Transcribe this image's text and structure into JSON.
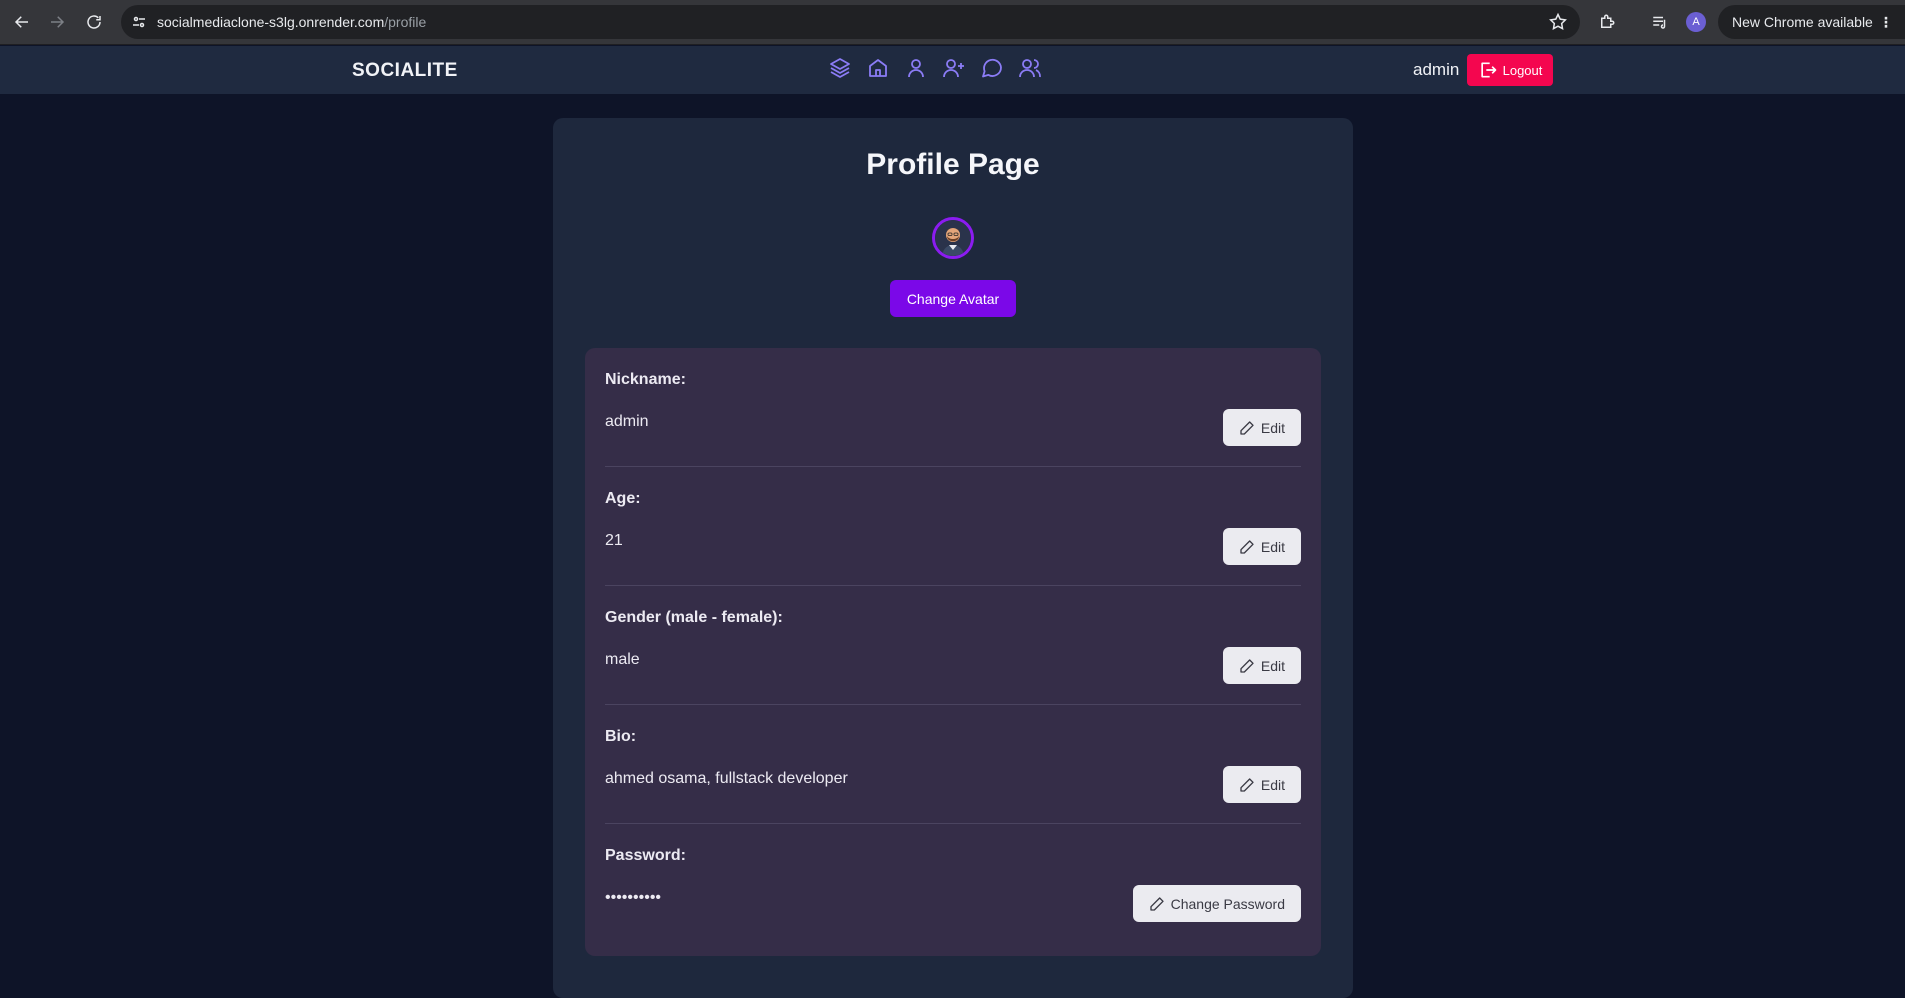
{
  "browser": {
    "url_host": "socialmediaclone-s3lg.onrender.com",
    "url_path": "/profile",
    "profile_initial": "A",
    "update_label": "New Chrome available"
  },
  "navbar": {
    "brand": "SOCIALITE",
    "icons": [
      "layers-icon",
      "home-icon",
      "user-icon",
      "user-plus-icon",
      "message-circle-icon",
      "users-icon"
    ],
    "username": "admin",
    "logout_label": "Logout"
  },
  "profile": {
    "title": "Profile Page",
    "change_avatar_label": "Change Avatar",
    "fields": [
      {
        "label": "Nickname:",
        "value": "admin",
        "button": "Edit"
      },
      {
        "label": "Age:",
        "value": "21",
        "button": "Edit"
      },
      {
        "label": "Gender (male - female):",
        "value": "male",
        "button": "Edit"
      },
      {
        "label": "Bio:",
        "value": "ahmed osama, fullstack developer",
        "button": "Edit"
      },
      {
        "label": "Password:",
        "value": "••••••••••",
        "button": "Change Password"
      }
    ]
  },
  "colors": {
    "background": "#0e1428",
    "navbar": "#1f2a40",
    "card": "#1e283d",
    "panel": "#352d48",
    "accent_purple": "#7b08e8",
    "nav_icon": "#8b7cf6",
    "logout_red": "#f4064f"
  }
}
